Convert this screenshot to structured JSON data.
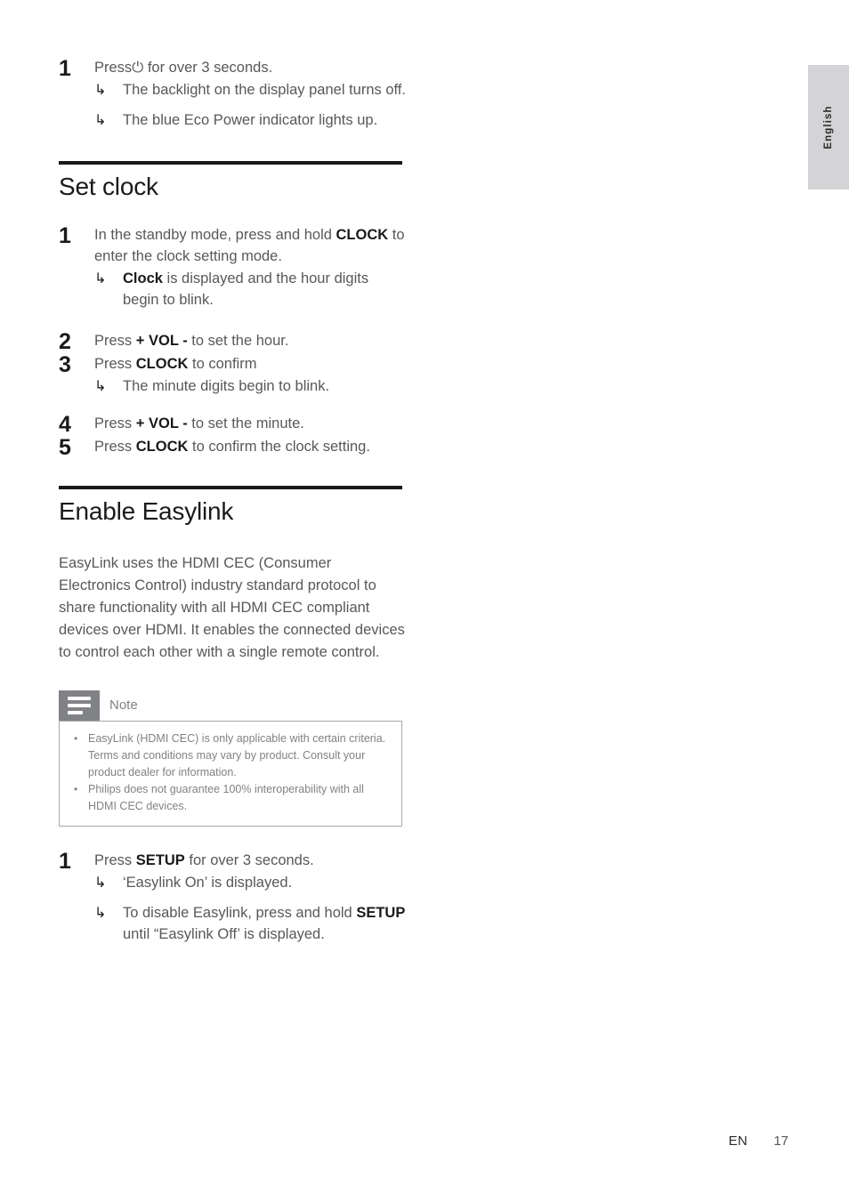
{
  "language_tab": {
    "label": "English"
  },
  "top_step": {
    "number": "1",
    "text_prefix": "Press",
    "power_icon": "⏻",
    "text_suffix": " for over 3 seconds.",
    "arrow": "↳",
    "sub_items": [
      "The backlight on the display panel turns off.",
      "The blue Eco Power indicator lights up."
    ]
  },
  "set_clock": {
    "title": "Set clock",
    "arrow": "↳",
    "steps": [
      {
        "number": "1",
        "text_a": "In the standby mode, press and hold ",
        "bold_a": "CLOCK",
        "text_b": " to enter the clock setting mode.",
        "sub_bold": "Clock",
        "sub_text": " is displayed and the hour digits begin to blink."
      },
      {
        "number": "2",
        "text_a": "Press ",
        "bold_a": "+ VOL -",
        "text_b": " to set the hour."
      },
      {
        "number": "3",
        "text_a": "Press ",
        "bold_a": "CLOCK",
        "text_b": " to confirm",
        "sub_text": "The minute digits begin to blink."
      },
      {
        "number": "4",
        "text_a": "Press ",
        "bold_a": "+ VOL -",
        "text_b": " to set the minute."
      },
      {
        "number": "5",
        "text_a": "Press ",
        "bold_a": "CLOCK",
        "text_b": " to confirm the clock setting."
      }
    ]
  },
  "enable_easylink": {
    "title": "Enable Easylink",
    "paragraph": "EasyLink uses the HDMI CEC (Consumer Electronics Control) industry standard protocol to share functionality with all HDMI CEC compliant devices over HDMI. It enables the connected devices to control each other with a single remote control.",
    "note": {
      "title": "Note",
      "bullet": "•",
      "items": [
        "EasyLink (HDMI CEC) is only applicable with certain criteria. Terms and conditions may vary by product. Consult your product dealer for information.",
        "Philips does not guarantee 100% interoperability with all HDMI CEC devices."
      ]
    },
    "step": {
      "number": "1",
      "arrow": "↳",
      "text_a": "Press ",
      "bold_a": "SETUP",
      "text_b": " for over 3 seconds.",
      "sub_1": "‘Easylink On’ is displayed.",
      "sub_2_a": "To disable Easylink, press and hold ",
      "sub_2_bold": "SETUP",
      "sub_2_b": " until “Easylink Off’ is displayed."
    }
  },
  "footer": {
    "locale": "EN",
    "page_number": "17"
  },
  "colors": {
    "body_text": "#58585a",
    "heading": "#1a1a1a",
    "note_gray": "#808285",
    "tab_gray": "#d4d4d6"
  }
}
